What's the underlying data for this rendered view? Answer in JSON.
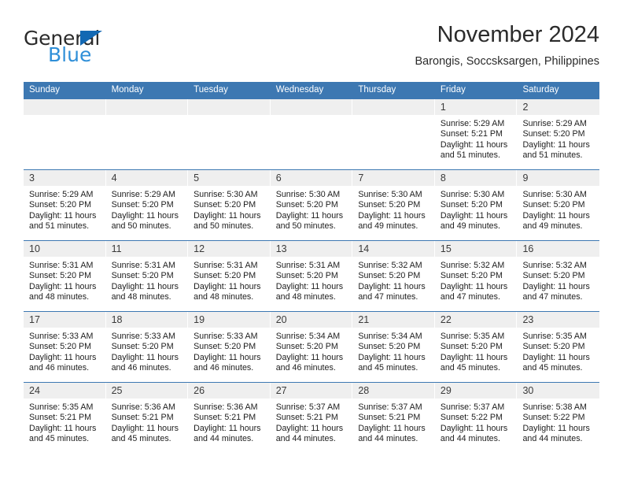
{
  "branding": {
    "logo_primary": "General",
    "logo_secondary": "Blue",
    "logo_primary_color": "#2b2b2b",
    "logo_secondary_color": "#2f8fd8",
    "logo_triangle_color": "#1268b3"
  },
  "header": {
    "title": "November 2024",
    "subtitle": "Barongis, Soccsksargen, Philippines",
    "header_bg_color": "#3d78b2",
    "daynum_band_color": "#efefef"
  },
  "weekdays": [
    "Sunday",
    "Monday",
    "Tuesday",
    "Wednesday",
    "Thursday",
    "Friday",
    "Saturday"
  ],
  "weeks": [
    [
      {
        "day": "",
        "empty": true
      },
      {
        "day": "",
        "empty": true
      },
      {
        "day": "",
        "empty": true
      },
      {
        "day": "",
        "empty": true
      },
      {
        "day": "",
        "empty": true
      },
      {
        "day": "1",
        "sunrise": "Sunrise: 5:29 AM",
        "sunset": "Sunset: 5:21 PM",
        "daylight1": "Daylight: 11 hours",
        "daylight2": "and 51 minutes."
      },
      {
        "day": "2",
        "sunrise": "Sunrise: 5:29 AM",
        "sunset": "Sunset: 5:20 PM",
        "daylight1": "Daylight: 11 hours",
        "daylight2": "and 51 minutes."
      }
    ],
    [
      {
        "day": "3",
        "sunrise": "Sunrise: 5:29 AM",
        "sunset": "Sunset: 5:20 PM",
        "daylight1": "Daylight: 11 hours",
        "daylight2": "and 51 minutes."
      },
      {
        "day": "4",
        "sunrise": "Sunrise: 5:29 AM",
        "sunset": "Sunset: 5:20 PM",
        "daylight1": "Daylight: 11 hours",
        "daylight2": "and 50 minutes."
      },
      {
        "day": "5",
        "sunrise": "Sunrise: 5:30 AM",
        "sunset": "Sunset: 5:20 PM",
        "daylight1": "Daylight: 11 hours",
        "daylight2": "and 50 minutes."
      },
      {
        "day": "6",
        "sunrise": "Sunrise: 5:30 AM",
        "sunset": "Sunset: 5:20 PM",
        "daylight1": "Daylight: 11 hours",
        "daylight2": "and 50 minutes."
      },
      {
        "day": "7",
        "sunrise": "Sunrise: 5:30 AM",
        "sunset": "Sunset: 5:20 PM",
        "daylight1": "Daylight: 11 hours",
        "daylight2": "and 49 minutes."
      },
      {
        "day": "8",
        "sunrise": "Sunrise: 5:30 AM",
        "sunset": "Sunset: 5:20 PM",
        "daylight1": "Daylight: 11 hours",
        "daylight2": "and 49 minutes."
      },
      {
        "day": "9",
        "sunrise": "Sunrise: 5:30 AM",
        "sunset": "Sunset: 5:20 PM",
        "daylight1": "Daylight: 11 hours",
        "daylight2": "and 49 minutes."
      }
    ],
    [
      {
        "day": "10",
        "sunrise": "Sunrise: 5:31 AM",
        "sunset": "Sunset: 5:20 PM",
        "daylight1": "Daylight: 11 hours",
        "daylight2": "and 48 minutes."
      },
      {
        "day": "11",
        "sunrise": "Sunrise: 5:31 AM",
        "sunset": "Sunset: 5:20 PM",
        "daylight1": "Daylight: 11 hours",
        "daylight2": "and 48 minutes."
      },
      {
        "day": "12",
        "sunrise": "Sunrise: 5:31 AM",
        "sunset": "Sunset: 5:20 PM",
        "daylight1": "Daylight: 11 hours",
        "daylight2": "and 48 minutes."
      },
      {
        "day": "13",
        "sunrise": "Sunrise: 5:31 AM",
        "sunset": "Sunset: 5:20 PM",
        "daylight1": "Daylight: 11 hours",
        "daylight2": "and 48 minutes."
      },
      {
        "day": "14",
        "sunrise": "Sunrise: 5:32 AM",
        "sunset": "Sunset: 5:20 PM",
        "daylight1": "Daylight: 11 hours",
        "daylight2": "and 47 minutes."
      },
      {
        "day": "15",
        "sunrise": "Sunrise: 5:32 AM",
        "sunset": "Sunset: 5:20 PM",
        "daylight1": "Daylight: 11 hours",
        "daylight2": "and 47 minutes."
      },
      {
        "day": "16",
        "sunrise": "Sunrise: 5:32 AM",
        "sunset": "Sunset: 5:20 PM",
        "daylight1": "Daylight: 11 hours",
        "daylight2": "and 47 minutes."
      }
    ],
    [
      {
        "day": "17",
        "sunrise": "Sunrise: 5:33 AM",
        "sunset": "Sunset: 5:20 PM",
        "daylight1": "Daylight: 11 hours",
        "daylight2": "and 46 minutes."
      },
      {
        "day": "18",
        "sunrise": "Sunrise: 5:33 AM",
        "sunset": "Sunset: 5:20 PM",
        "daylight1": "Daylight: 11 hours",
        "daylight2": "and 46 minutes."
      },
      {
        "day": "19",
        "sunrise": "Sunrise: 5:33 AM",
        "sunset": "Sunset: 5:20 PM",
        "daylight1": "Daylight: 11 hours",
        "daylight2": "and 46 minutes."
      },
      {
        "day": "20",
        "sunrise": "Sunrise: 5:34 AM",
        "sunset": "Sunset: 5:20 PM",
        "daylight1": "Daylight: 11 hours",
        "daylight2": "and 46 minutes."
      },
      {
        "day": "21",
        "sunrise": "Sunrise: 5:34 AM",
        "sunset": "Sunset: 5:20 PM",
        "daylight1": "Daylight: 11 hours",
        "daylight2": "and 45 minutes."
      },
      {
        "day": "22",
        "sunrise": "Sunrise: 5:35 AM",
        "sunset": "Sunset: 5:20 PM",
        "daylight1": "Daylight: 11 hours",
        "daylight2": "and 45 minutes."
      },
      {
        "day": "23",
        "sunrise": "Sunrise: 5:35 AM",
        "sunset": "Sunset: 5:20 PM",
        "daylight1": "Daylight: 11 hours",
        "daylight2": "and 45 minutes."
      }
    ],
    [
      {
        "day": "24",
        "sunrise": "Sunrise: 5:35 AM",
        "sunset": "Sunset: 5:21 PM",
        "daylight1": "Daylight: 11 hours",
        "daylight2": "and 45 minutes."
      },
      {
        "day": "25",
        "sunrise": "Sunrise: 5:36 AM",
        "sunset": "Sunset: 5:21 PM",
        "daylight1": "Daylight: 11 hours",
        "daylight2": "and 45 minutes."
      },
      {
        "day": "26",
        "sunrise": "Sunrise: 5:36 AM",
        "sunset": "Sunset: 5:21 PM",
        "daylight1": "Daylight: 11 hours",
        "daylight2": "and 44 minutes."
      },
      {
        "day": "27",
        "sunrise": "Sunrise: 5:37 AM",
        "sunset": "Sunset: 5:21 PM",
        "daylight1": "Daylight: 11 hours",
        "daylight2": "and 44 minutes."
      },
      {
        "day": "28",
        "sunrise": "Sunrise: 5:37 AM",
        "sunset": "Sunset: 5:21 PM",
        "daylight1": "Daylight: 11 hours",
        "daylight2": "and 44 minutes."
      },
      {
        "day": "29",
        "sunrise": "Sunrise: 5:37 AM",
        "sunset": "Sunset: 5:22 PM",
        "daylight1": "Daylight: 11 hours",
        "daylight2": "and 44 minutes."
      },
      {
        "day": "30",
        "sunrise": "Sunrise: 5:38 AM",
        "sunset": "Sunset: 5:22 PM",
        "daylight1": "Daylight: 11 hours",
        "daylight2": "and 44 minutes."
      }
    ]
  ]
}
